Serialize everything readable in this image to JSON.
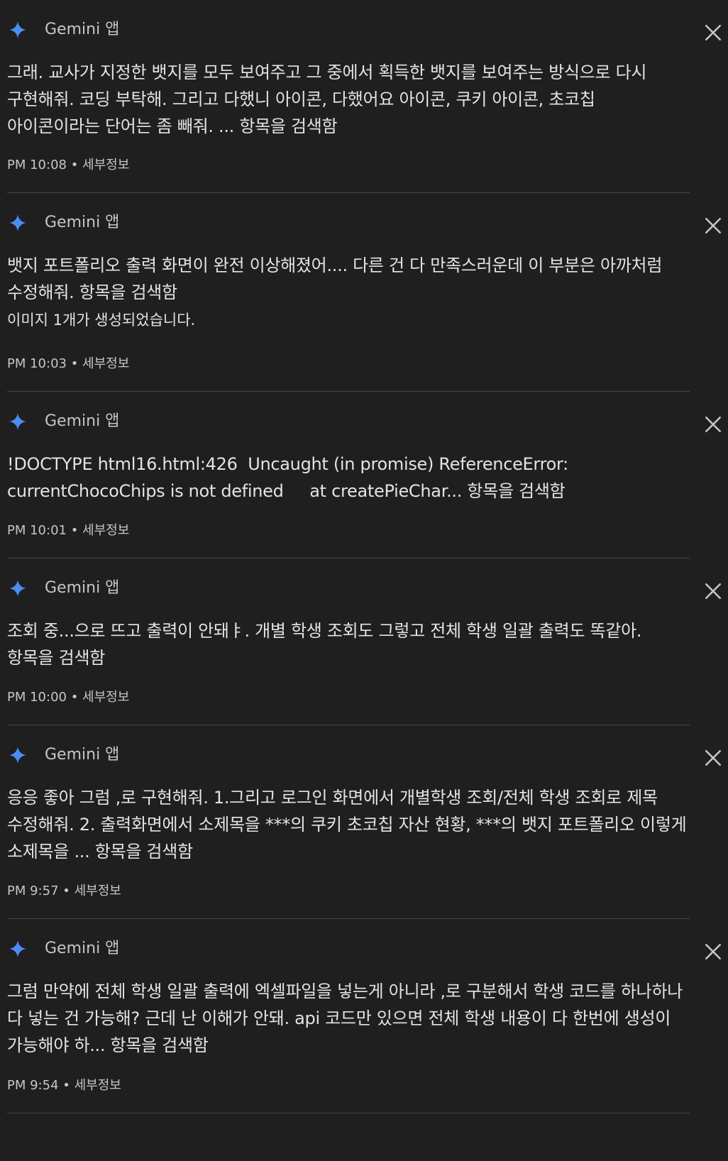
{
  "app_label": "Gemini 앱",
  "details_label": "세부정보",
  "separator": " • ",
  "items": [
    {
      "text": "그래. 교사가 지정한 뱃지를 모두 보여주고 그 중에서 획득한 뱃지를 보여주는 방식으로 다시 구현해줘. 코딩 부탁해. 그리고 다했니 아이콘, 다했어요 아이콘, 쿠키 아이콘, 초코칩 아이콘이라는 단어는 좀 빼줘. ... 항목을 검색함",
      "extra": "",
      "time": "PM 10:08"
    },
    {
      "text": "뱃지 포트폴리오 출력 화면이 완전 이상해졌어.... 다른 건 다 만족스러운데 이 부분은 아까처럼 수정해줘. 항목을 검색함",
      "extra": "이미지 1개가 생성되었습니다.",
      "time": "PM 10:03"
    },
    {
      "text": "!DOCTYPE html16.html:426  Uncaught (in promise) ReferenceError: currentChocoChips is not defined     at createPieChar... 항목을 검색함",
      "extra": "",
      "time": "PM 10:01"
    },
    {
      "text": "조회 중...으로 뜨고 출력이 안돼ㅑ. 개별 학생 조회도 그렇고 전체 학생 일괄 출력도 똑같아. 항목을 검색함",
      "extra": "",
      "time": "PM 10:00"
    },
    {
      "text": "응응 좋아 그럼 ,로 구현해줘. 1.그리고 로그인 화면에서 개별학생 조회/전체 학생 조회로 제목 수정해줘. 2. 출력화면에서 소제목을 ***의 쿠키 초코칩 자산 현황, ***의 뱃지 포트폴리오 이렇게 소제목을 ... 항목을 검색함",
      "extra": "",
      "time": "PM 9:57"
    },
    {
      "text": "그럼 만약에 전체 학생 일괄 출력에 엑셀파일을 넣는게 아니라 ,로 구분해서 학생 코드를 하나하나 다 넣는 건 가능해? 근데 난 이해가 안돼. api 코드만 있으면 전체 학생 내용이 다 한번에 생성이 가능해야 하... 항목을 검색함",
      "extra": "",
      "time": "PM 9:54"
    }
  ]
}
